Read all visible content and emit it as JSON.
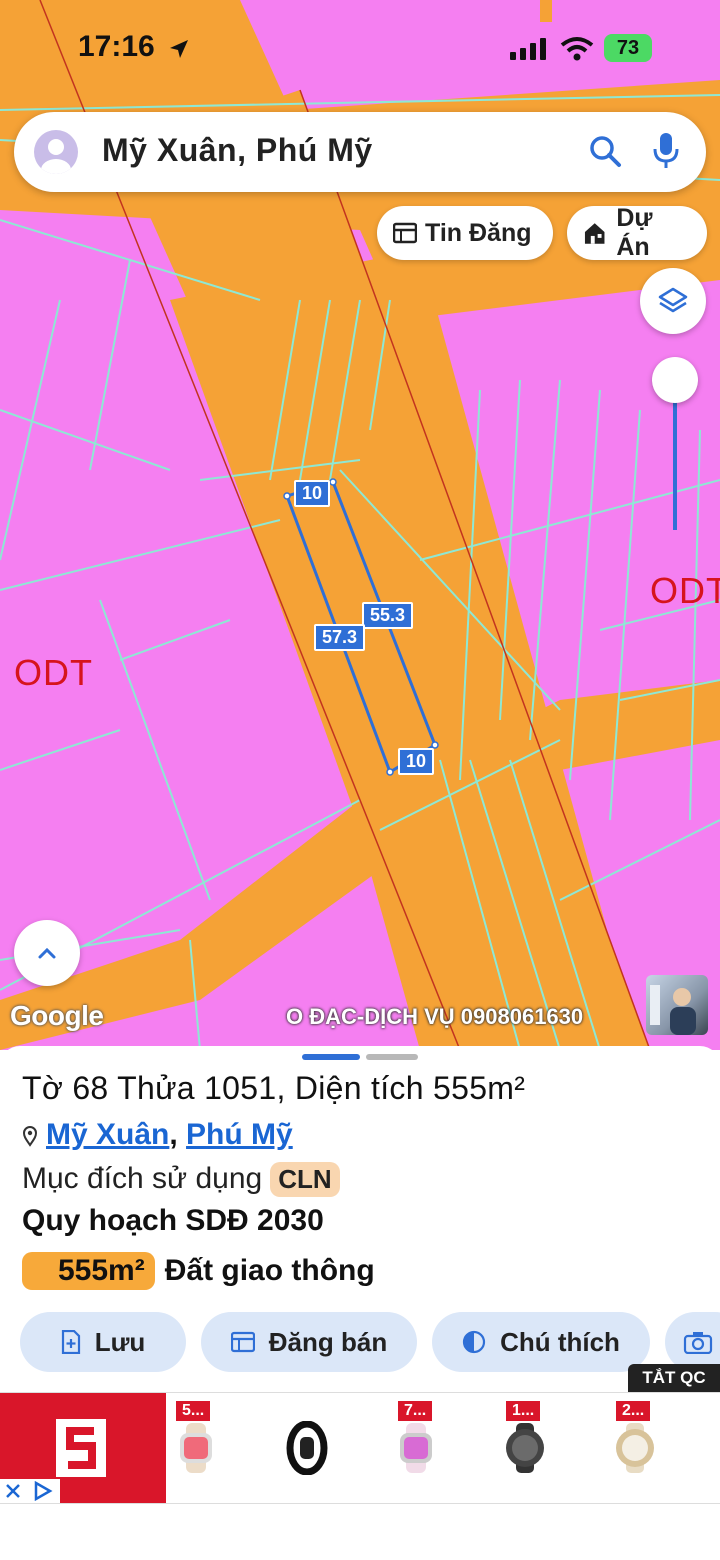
{
  "status_bar": {
    "time": "17:16",
    "battery": "73"
  },
  "search": {
    "query": "Mỹ Xuân, Phú Mỹ"
  },
  "buttons": {
    "listings": "Tin Đăng",
    "projects": "Dự Án"
  },
  "map": {
    "zone_label_left": "ODT",
    "zone_label_right": "ODT",
    "dimensions": {
      "top": "10",
      "right": "55.3",
      "left": "57.3",
      "bottom": "10"
    },
    "google": "Google",
    "watermark": "O ĐẠC-DỊCH VỤ 0908061630"
  },
  "parcel": {
    "title": "Tờ 68 Thửa 1051, Diện tích 555m²",
    "location_commune": "Mỹ Xuân",
    "location_separator": ",",
    "location_town": "Phú Mỹ",
    "purpose_label": "Mục đích sử dụng",
    "purpose_code": "CLN",
    "plan_title": "Quy hoạch SDĐ 2030",
    "plan_area": "555m²",
    "plan_use": "Đất giao thông"
  },
  "actions": {
    "save": "Lưu",
    "post": "Đăng bán",
    "legend": "Chú thích"
  },
  "ad": {
    "hide_label": "TẮT QC",
    "tags": [
      "5...",
      "7...",
      "1...",
      "2..."
    ]
  },
  "colors": {
    "residential": "#f57ff1",
    "transport": "#f5a236",
    "accent": "#2f6fd6",
    "parcel_lines": "#8ee8d4"
  }
}
